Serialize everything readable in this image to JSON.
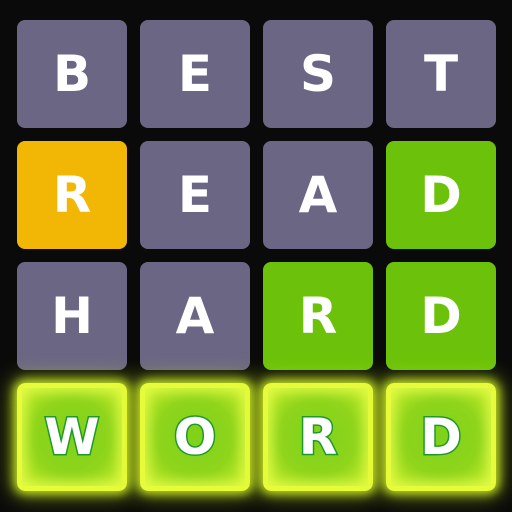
{
  "board": {
    "rows": [
      {
        "word": "BEST",
        "tiles": [
          {
            "letter": "B",
            "state": "absent"
          },
          {
            "letter": "E",
            "state": "absent"
          },
          {
            "letter": "S",
            "state": "absent"
          },
          {
            "letter": "T",
            "state": "absent"
          }
        ]
      },
      {
        "word": "READ",
        "tiles": [
          {
            "letter": "R",
            "state": "present"
          },
          {
            "letter": "E",
            "state": "absent"
          },
          {
            "letter": "A",
            "state": "absent"
          },
          {
            "letter": "D",
            "state": "correct"
          }
        ]
      },
      {
        "word": "HARD",
        "tiles": [
          {
            "letter": "H",
            "state": "absent"
          },
          {
            "letter": "A",
            "state": "absent"
          },
          {
            "letter": "R",
            "state": "correct"
          },
          {
            "letter": "D",
            "state": "correct"
          }
        ]
      },
      {
        "word": "WORD",
        "tiles": [
          {
            "letter": "W",
            "state": "answer"
          },
          {
            "letter": "O",
            "state": "answer"
          },
          {
            "letter": "R",
            "state": "answer"
          },
          {
            "letter": "D",
            "state": "answer"
          }
        ]
      }
    ]
  },
  "colors": {
    "background": "#0a0a0a",
    "absent": "#6b6684",
    "present": "#f2b705",
    "correct": "#6cc20a",
    "answer_glow": "#e6fb3a",
    "answer_letter_outline": "#1f9a2a"
  }
}
